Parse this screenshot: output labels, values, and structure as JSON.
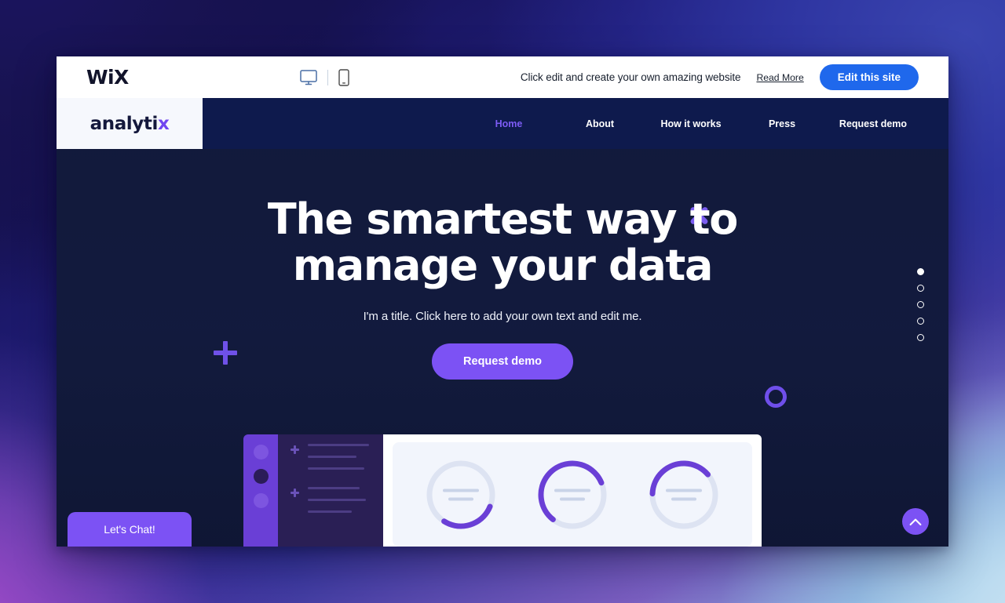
{
  "editor_bar": {
    "logo_text": "WiX",
    "desktop_icon": "desktop-monitor-icon",
    "mobile_icon": "mobile-phone-icon",
    "promo_text": "Click edit and create your own amazing website",
    "read_more_label": "Read More",
    "edit_button_label": "Edit this site",
    "accent_color": "#1f68ec"
  },
  "site_header": {
    "brand_name": "analyti",
    "brand_accent_letter": "x",
    "brand_accent_color": "#7046f0",
    "background_color": "#0e1a4d",
    "nav_items": [
      {
        "label": "Home",
        "active": true
      },
      {
        "label": "About",
        "active": false
      },
      {
        "label": "How it works",
        "active": false
      },
      {
        "label": "Press",
        "active": false
      },
      {
        "label": "Request demo",
        "active": false
      }
    ]
  },
  "hero": {
    "title": "The smartest way to manage your data",
    "subtitle": "I'm a title. Click here to add your own text and edit me.",
    "cta_label": "Request demo",
    "cta_color": "#7c52f4",
    "decorations": {
      "plus_icon": "plus-decoration-icon",
      "x_icon": "x-flower-decoration-icon",
      "ring_icon": "ring-decoration-icon"
    },
    "slider_dots": {
      "total": 5,
      "active_index": 0
    },
    "scroll_top_icon": "chevron-up-icon"
  },
  "dashboard_graphic": {
    "rail_dots": 3,
    "side_groups": [
      {
        "plus_icon": "plus-icon",
        "lines": 3
      },
      {
        "plus_icon": "plus-icon",
        "lines": 3
      }
    ],
    "donuts": [
      {
        "name": "donut-chart-1",
        "percent": 28,
        "rotation": 92,
        "color": "#6a3fd6",
        "track": "#dde3f2"
      },
      {
        "name": "donut-chart-2",
        "percent": 58,
        "rotation": 160,
        "color": "#6a3fd6",
        "track": "#dde3f2"
      },
      {
        "name": "donut-chart-3",
        "percent": 38,
        "rotation": 205,
        "color": "#6a3fd6",
        "track": "#dde3f2"
      }
    ]
  },
  "chat_widget": {
    "label": "Let's Chat!",
    "color": "#7c52f4"
  }
}
